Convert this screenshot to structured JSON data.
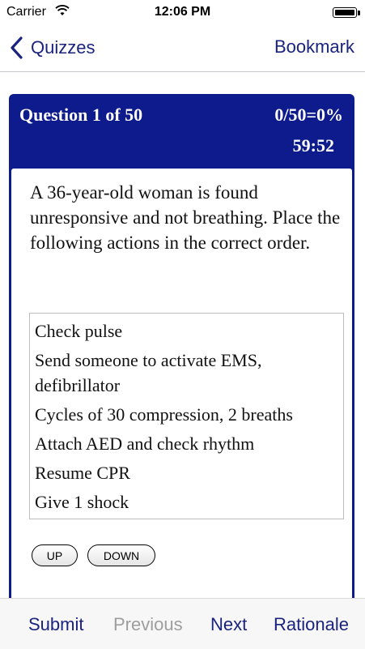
{
  "status_bar": {
    "carrier": "Carrier",
    "time": "12:06 PM"
  },
  "nav": {
    "back_label": "Quizzes",
    "bookmark_label": "Bookmark"
  },
  "question": {
    "title": "Question 1 of 50",
    "score": "0/50=0%",
    "timer": "59:52",
    "text": "A 36-year-old woman is found unresponsive and not breathing. Place the following actions in the correct order.",
    "answers": [
      "Check pulse",
      "Send someone to activate EMS, defibrillator",
      "Cycles of 30 compression, 2 breaths",
      "Attach AED and check rhythm",
      "Resume CPR",
      "Give 1 shock"
    ],
    "up_label": "UP",
    "down_label": "DOWN"
  },
  "toolbar": {
    "submit_label": "Submit",
    "previous_label": "Previous",
    "next_label": "Next",
    "rationale_label": "Rationale"
  },
  "colors": {
    "accent": "#1a237e",
    "card_header": "#0d1b8c",
    "disabled": "#9e9e9e"
  },
  "icons": {
    "wifi": "wifi-icon",
    "battery": "battery-icon",
    "back": "chevron-left-icon"
  }
}
